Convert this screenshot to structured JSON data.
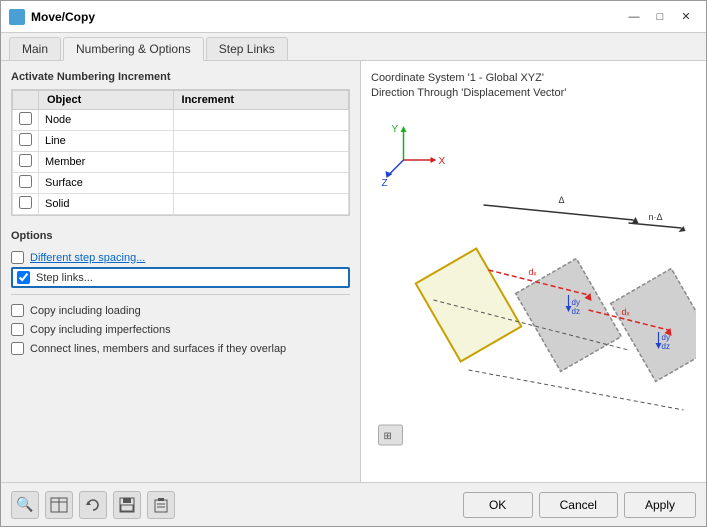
{
  "window": {
    "title": "Move/Copy",
    "icon": "M"
  },
  "title_buttons": {
    "minimize": "—",
    "maximize": "□",
    "close": "✕"
  },
  "tabs": [
    {
      "label": "Main",
      "active": false
    },
    {
      "label": "Numbering & Options",
      "active": true
    },
    {
      "label": "Step Links",
      "active": false
    }
  ],
  "numbering_section": {
    "title": "Activate Numbering Increment",
    "columns": [
      "Object",
      "Increment"
    ],
    "rows": [
      {
        "checked": false,
        "object": "Node",
        "increment": ""
      },
      {
        "checked": false,
        "object": "Line",
        "increment": ""
      },
      {
        "checked": false,
        "object": "Member",
        "increment": ""
      },
      {
        "checked": false,
        "object": "Surface",
        "increment": ""
      },
      {
        "checked": false,
        "object": "Solid",
        "increment": ""
      }
    ]
  },
  "options_section": {
    "title": "Options",
    "items": [
      {
        "checked": false,
        "label": "Different step spacing...",
        "blue": true,
        "highlighted": false
      },
      {
        "checked": true,
        "label": "Step links...",
        "blue": false,
        "highlighted": true
      },
      {
        "separator": true
      },
      {
        "checked": false,
        "label": "Copy including loading",
        "blue": false,
        "highlighted": false
      },
      {
        "checked": false,
        "label": "Copy including imperfections",
        "blue": false,
        "highlighted": false
      },
      {
        "checked": false,
        "label": "Connect lines, members and surfaces if they overlap",
        "blue": false,
        "highlighted": false
      }
    ]
  },
  "coord_info": {
    "line1": "Coordinate System '1 - Global XYZ'",
    "line2": "Direction Through 'Displacement Vector'"
  },
  "buttons": {
    "ok": "OK",
    "cancel": "Cancel",
    "apply": "Apply"
  },
  "bottom_icons": [
    "🔍",
    "📊",
    "🔄",
    "💾",
    "📋"
  ]
}
